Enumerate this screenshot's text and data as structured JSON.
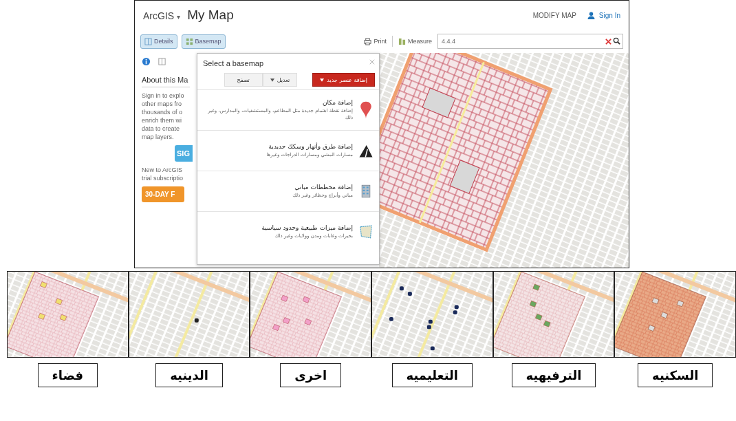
{
  "header": {
    "logo": "ArcGIS",
    "logo_caret": "▾",
    "title": "My Map",
    "modify": "MODIFY MAP",
    "sign_in": "Sign In"
  },
  "toolbar": {
    "details": "Details",
    "basemap": "Basemap",
    "print": "Print",
    "measure": "Measure",
    "search_value": "4.4.4"
  },
  "sidebar": {
    "heading": "About this Ma",
    "lines": [
      "Sign in to explo",
      "other maps fro",
      "thousands of o",
      "enrich them wi",
      "data to create",
      "map layers."
    ],
    "sign_button": "SIG",
    "new_lines": [
      "New to ArcGIS",
      "trial subscriptio"
    ],
    "trial_button": "30-DAY F"
  },
  "basemap_panel": {
    "title": "Select a basemap",
    "buttons": [
      {
        "label": "إضافة عنصر جديد",
        "kind": "primary"
      },
      {
        "label": "تعديل",
        "kind": "dropdown"
      },
      {
        "label": "تصفح",
        "kind": "plain"
      }
    ],
    "items": [
      {
        "kind": "pin",
        "title": "إضافة مكان",
        "description": "إضافة نقطة اهتمام جديدة مثل المطاعم، والمستشفيات، والمدارس، وغير ذلك"
      },
      {
        "kind": "road",
        "title": "إضافة طرق وأنهار وسكك حديدية",
        "description": "مسارات المشي ومسارات الدراجات وغيرها"
      },
      {
        "kind": "building",
        "title": "إضافة مخططات مباني",
        "description": "مباني وأبراج وحظائر وغير ذلك"
      },
      {
        "kind": "boundary",
        "title": "إضافة ميزات طبيعية وحدود سياسية",
        "description": "بحيرات وغابات ومدن وولايات وغير ذلك"
      }
    ]
  },
  "thumbnails": [
    {
      "kind": "residential",
      "label": "السكنيه"
    },
    {
      "kind": "recreational",
      "label": "الترفيهيه"
    },
    {
      "kind": "educational",
      "label": "التعليميه"
    },
    {
      "kind": "other",
      "label": "اخرى"
    },
    {
      "kind": "religious",
      "label": "الدينيه"
    },
    {
      "kind": "vacant",
      "label": "فضاء"
    }
  ]
}
